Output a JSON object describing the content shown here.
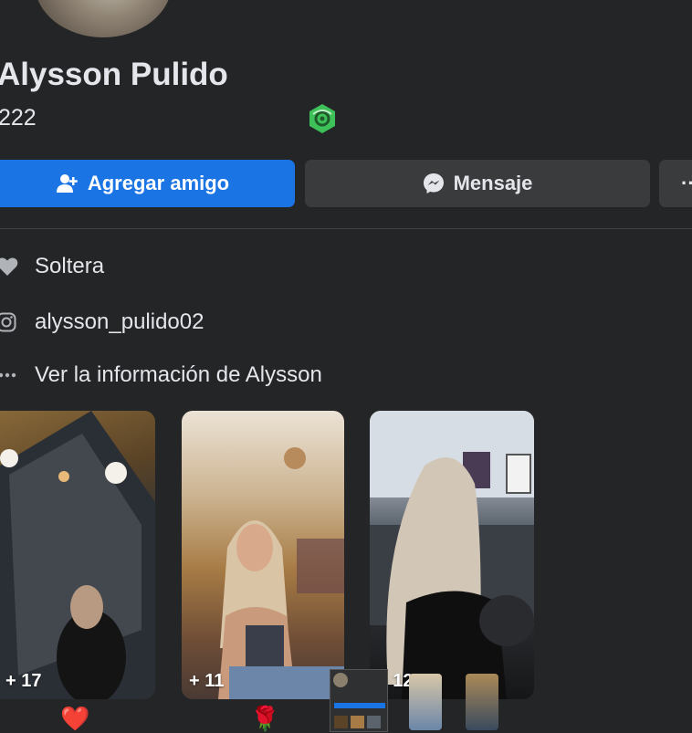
{
  "profile": {
    "name": "Alysson Pulido",
    "friends_count": "222",
    "badge_icon": "green-badge-icon"
  },
  "actions": {
    "add_friend_label": "Agregar amigo",
    "message_label": "Mensaje",
    "more_label": "···"
  },
  "info": {
    "relationship": "Soltera",
    "instagram": "alysson_pulido02",
    "see_more": "Ver la información de Alysson"
  },
  "photos": [
    {
      "count": "+ 17"
    },
    {
      "count": "+ 11"
    },
    {
      "count": "+ 12"
    }
  ],
  "reactions": [
    "❤️",
    "🌹"
  ],
  "colors": {
    "background": "#242526",
    "primary_button": "#1b74e4",
    "secondary_button": "#3a3b3c",
    "text": "#e4e6eb"
  }
}
